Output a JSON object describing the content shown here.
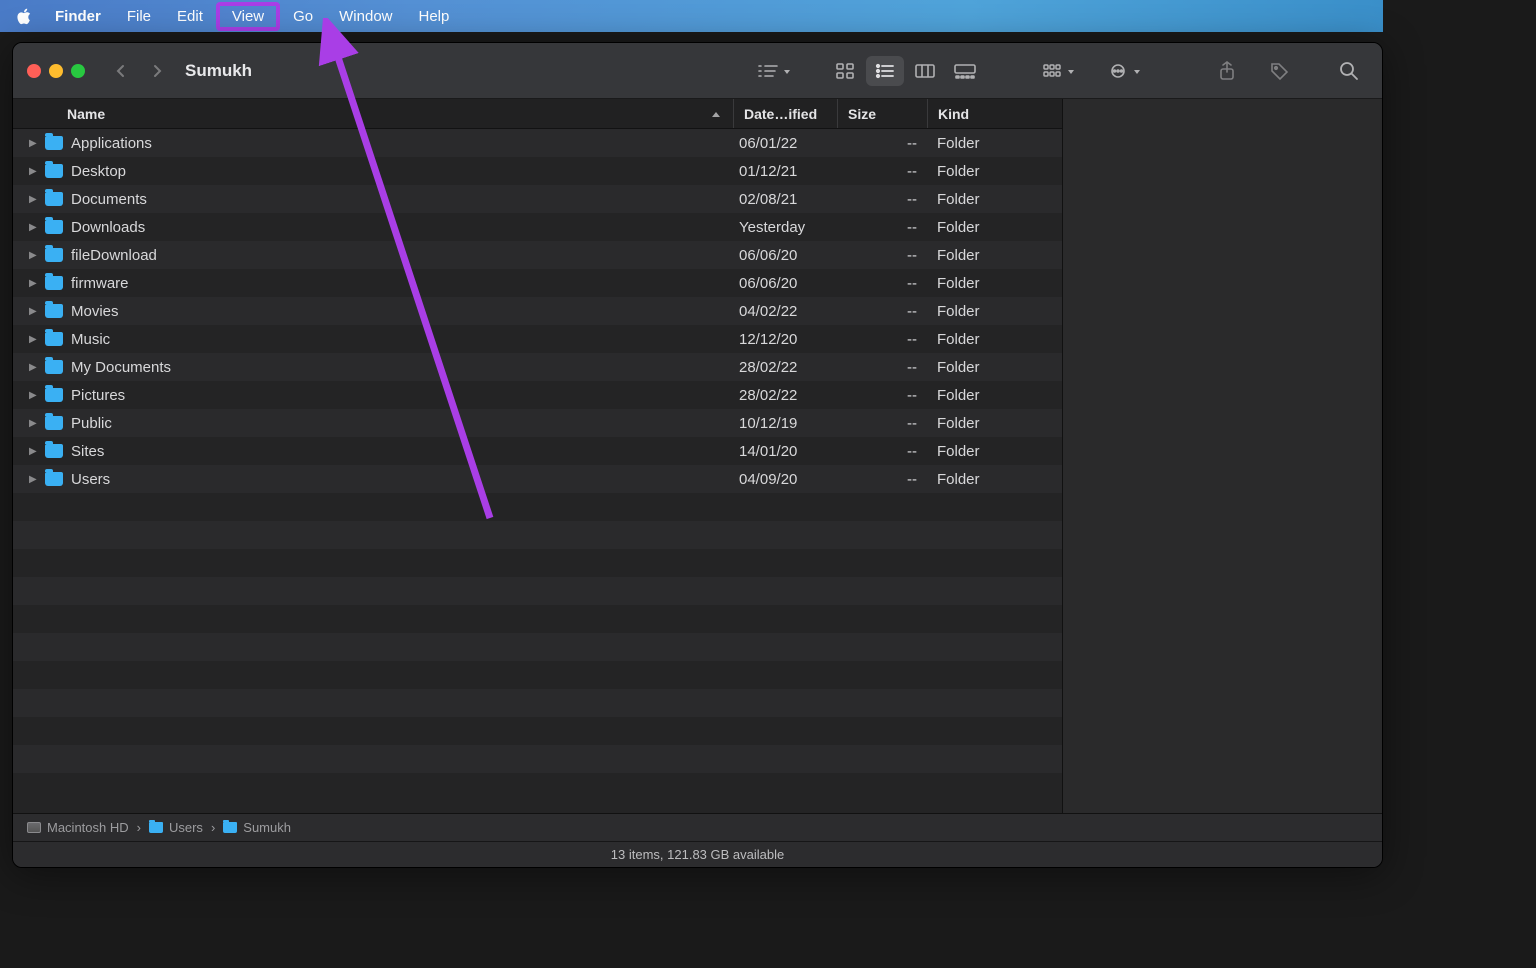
{
  "menubar": {
    "app": "Finder",
    "items": [
      "File",
      "Edit",
      "View",
      "Go",
      "Window",
      "Help"
    ],
    "highlighted": "View"
  },
  "toolbar": {
    "title": "Sumukh"
  },
  "columns": {
    "name": "Name",
    "date": "Date…ified",
    "size": "Size",
    "kind": "Kind"
  },
  "rows": [
    {
      "name": "Applications",
      "date": "06/01/22",
      "size": "--",
      "kind": "Folder"
    },
    {
      "name": "Desktop",
      "date": "01/12/21",
      "size": "--",
      "kind": "Folder"
    },
    {
      "name": "Documents",
      "date": "02/08/21",
      "size": "--",
      "kind": "Folder"
    },
    {
      "name": "Downloads",
      "date": "Yesterday",
      "size": "--",
      "kind": "Folder"
    },
    {
      "name": "fileDownload",
      "date": "06/06/20",
      "size": "--",
      "kind": "Folder"
    },
    {
      "name": "firmware",
      "date": "06/06/20",
      "size": "--",
      "kind": "Folder"
    },
    {
      "name": "Movies",
      "date": "04/02/22",
      "size": "--",
      "kind": "Folder"
    },
    {
      "name": "Music",
      "date": "12/12/20",
      "size": "--",
      "kind": "Folder"
    },
    {
      "name": "My Documents",
      "date": "28/02/22",
      "size": "--",
      "kind": "Folder"
    },
    {
      "name": "Pictures",
      "date": "28/02/22",
      "size": "--",
      "kind": "Folder"
    },
    {
      "name": "Public",
      "date": "10/12/19",
      "size": "--",
      "kind": "Folder"
    },
    {
      "name": "Sites",
      "date": "14/01/20",
      "size": "--",
      "kind": "Folder"
    },
    {
      "name": "Users",
      "date": "04/09/20",
      "size": "--",
      "kind": "Folder"
    }
  ],
  "path": [
    "Macintosh HD",
    "Users",
    "Sumukh"
  ],
  "status": "13 items, 121.83 GB available",
  "annotation": {
    "highlight": "View",
    "color": "#a93ee6"
  }
}
